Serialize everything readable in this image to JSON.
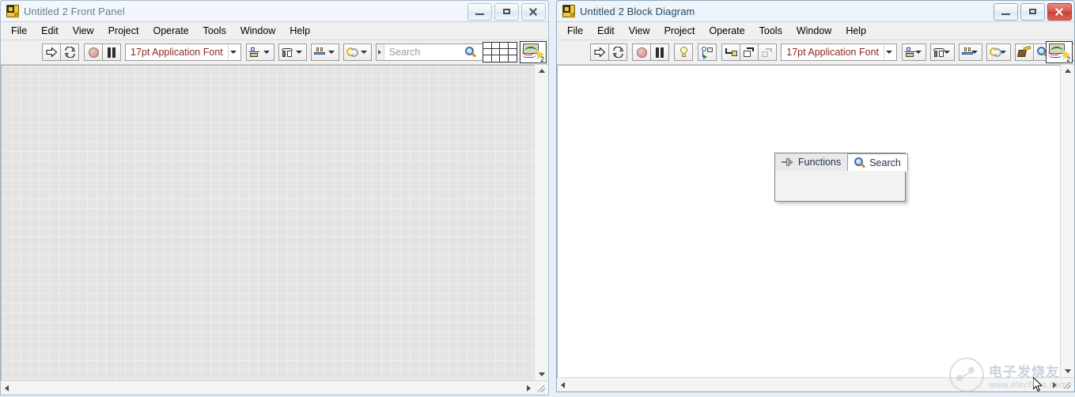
{
  "windows": [
    {
      "id": "front-panel",
      "title": "Untitled 2 Front Panel",
      "active": false,
      "menu": [
        "File",
        "Edit",
        "View",
        "Project",
        "Operate",
        "Tools",
        "Window",
        "Help"
      ],
      "toolbar": {
        "run": "run-button",
        "run_continuously": "run-continuously-button",
        "abort": "abort-execution-button",
        "pause": "pause-button",
        "font": "17pt Application Font",
        "align": "align-objects-button",
        "distribute": "distribute-objects-button",
        "resize": "resize-objects-button",
        "reorder": "reorder-button",
        "search_placeholder": "Search",
        "help": "context-help-button"
      },
      "vi_icon_number": "2",
      "window_buttons": {
        "minimize": "Minimize",
        "maximize": "Maximize",
        "close": "Close"
      }
    },
    {
      "id": "block-diagram",
      "title": "Untitled 2 Block Diagram",
      "active": true,
      "menu": [
        "File",
        "Edit",
        "View",
        "Project",
        "Operate",
        "Tools",
        "Window",
        "Help"
      ],
      "toolbar": {
        "run": "run-button",
        "run_continuously": "run-continuously-button",
        "abort": "abort-execution-button",
        "pause": "pause-button",
        "highlight": "highlight-execution-button",
        "retain_wire_values": "retain-wire-values-button",
        "step_into": "step-into-button",
        "step_over": "step-over-button",
        "step_out": "step-out-button",
        "font": "17pt Application Font",
        "align": "align-objects-button",
        "distribute": "distribute-objects-button",
        "resize": "resize-objects-button",
        "reorder": "reorder-button",
        "cleanup": "clean-up-diagram-button",
        "search": "search-button",
        "help": "context-help-button"
      },
      "vi_icon_number": "2",
      "window_buttons": {
        "minimize": "Minimize",
        "maximize": "Maximize",
        "close": "Close"
      }
    }
  ],
  "palette": {
    "functions_tab": "Functions",
    "search_tab": "Search",
    "pin_icon": "pin-icon",
    "search_icon": "search-icon"
  },
  "watermark": {
    "cn": "电子发烧友",
    "en": "www.elecfans.com"
  },
  "colors": {
    "close_active": "#c73d34",
    "title_text": "#274863",
    "font_label": "#8a2a1f",
    "fp_grid": "#e4e4e4",
    "bd_canvas": "#ffffff"
  }
}
